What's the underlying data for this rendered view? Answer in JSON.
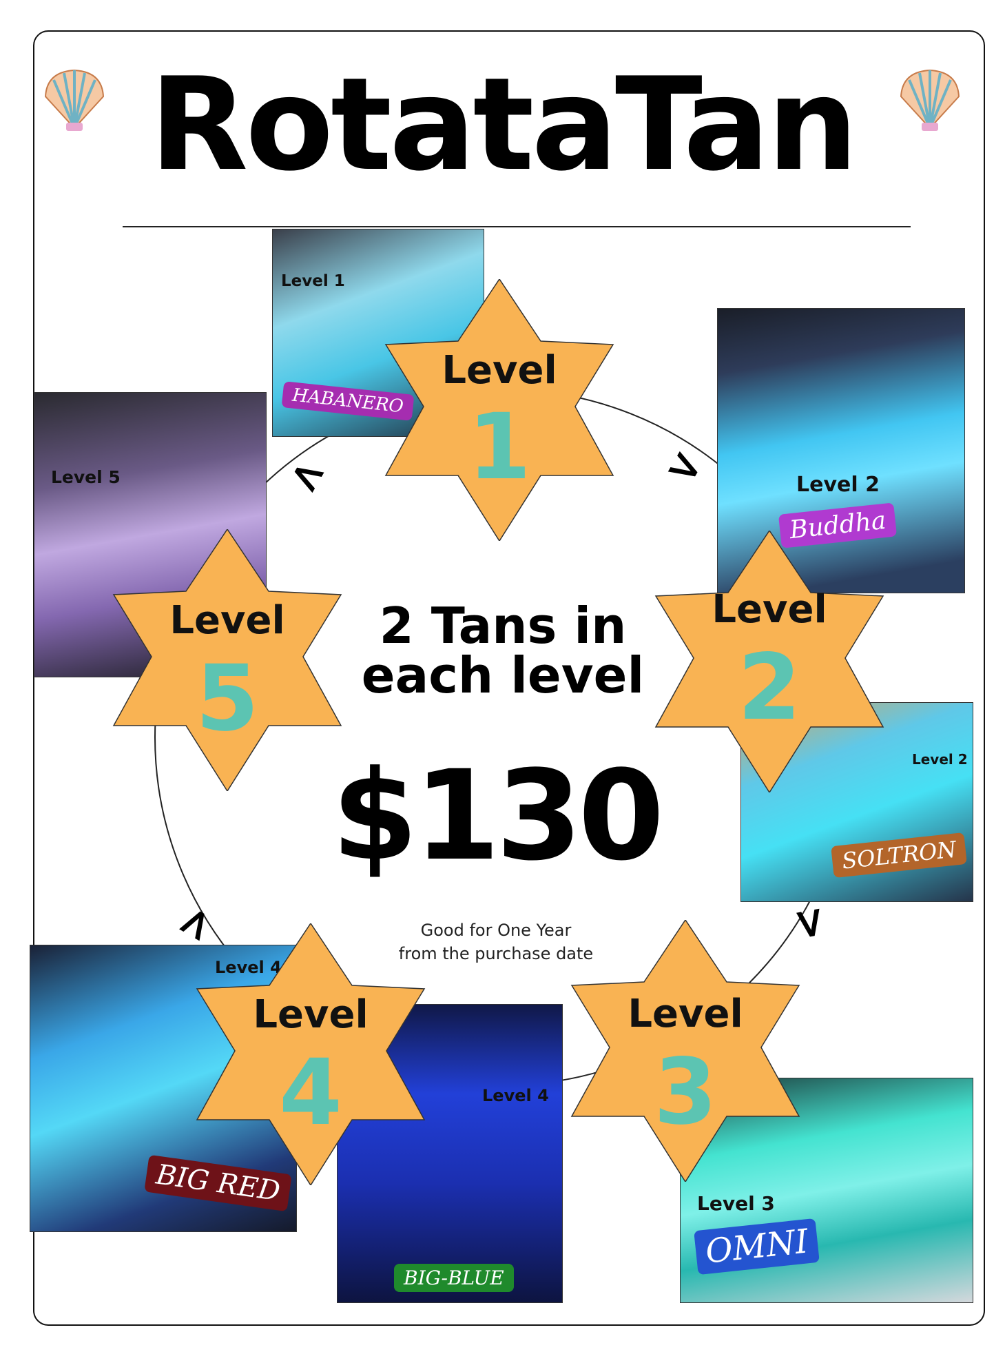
{
  "title": "RotataTan",
  "center": {
    "headline_line1": "2 Tans in",
    "headline_line2": "each level",
    "price": "$130",
    "validity_line1": "Good for One Year",
    "validity_line2": "from the purchase date"
  },
  "stars": [
    {
      "word": "Level",
      "number": "1"
    },
    {
      "word": "Level",
      "number": "2"
    },
    {
      "word": "Level",
      "number": "3"
    },
    {
      "word": "Level",
      "number": "4"
    },
    {
      "word": "Level",
      "number": "5"
    }
  ],
  "beds": [
    {
      "level_label": "Level 1",
      "name": "HABANERO",
      "tag_color": "#a52db0"
    },
    {
      "level_label": "Level 2",
      "name": "Buddha",
      "tag_color": "#b03ad0"
    },
    {
      "level_label": "Level 2",
      "name": "SOLTRON",
      "tag_color": "#b3652a"
    },
    {
      "level_label": "Level 3",
      "name": "OMNI",
      "tag_color": "#2454d0"
    },
    {
      "level_label": "Level 4",
      "name": "BIG-BLUE",
      "tag_color": "#1f8a2c"
    },
    {
      "level_label": "Level 4",
      "name": "BIG RED",
      "tag_color": "#6e1218"
    },
    {
      "level_label": "Level 5",
      "name": "",
      "tag_color": ""
    }
  ],
  "colors": {
    "star_fill": "#f9b353",
    "number_color": "#5cc4b2",
    "text": "#000000"
  },
  "icons": [
    "seashell-icon",
    "seashell-icon"
  ]
}
